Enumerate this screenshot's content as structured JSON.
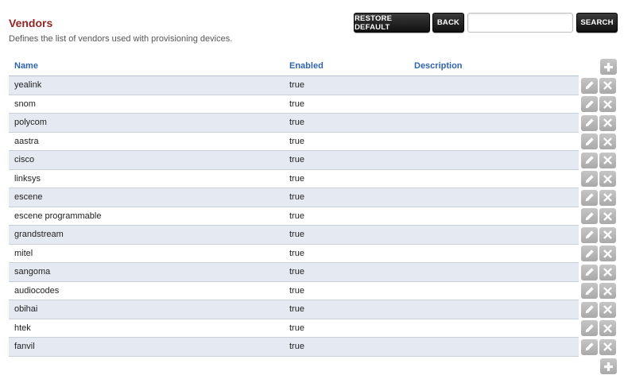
{
  "page": {
    "title": "Vendors",
    "description": "Defines the list of vendors used with provisioning devices."
  },
  "toolbar": {
    "restore_label": "RESTORE DEFAULT",
    "back_label": "BACK",
    "search_placeholder": "",
    "search_value": "",
    "search_label": "SEARCH"
  },
  "table": {
    "headers": {
      "name": "Name",
      "enabled": "Enabled",
      "description": "Description"
    },
    "rows": [
      {
        "name": "yealink",
        "enabled": "true",
        "description": ""
      },
      {
        "name": "snom",
        "enabled": "true",
        "description": ""
      },
      {
        "name": "polycom",
        "enabled": "true",
        "description": ""
      },
      {
        "name": "aastra",
        "enabled": "true",
        "description": ""
      },
      {
        "name": "cisco",
        "enabled": "true",
        "description": ""
      },
      {
        "name": "linksys",
        "enabled": "true",
        "description": ""
      },
      {
        "name": "escene",
        "enabled": "true",
        "description": ""
      },
      {
        "name": "escene programmable",
        "enabled": "true",
        "description": ""
      },
      {
        "name": "grandstream",
        "enabled": "true",
        "description": ""
      },
      {
        "name": "mitel",
        "enabled": "true",
        "description": ""
      },
      {
        "name": "sangoma",
        "enabled": "true",
        "description": ""
      },
      {
        "name": "audiocodes",
        "enabled": "true",
        "description": ""
      },
      {
        "name": "obihai",
        "enabled": "true",
        "description": ""
      },
      {
        "name": "htek",
        "enabled": "true",
        "description": ""
      },
      {
        "name": "fanvil",
        "enabled": "true",
        "description": ""
      }
    ]
  },
  "icons": {
    "add": "plus-icon",
    "edit": "pencil-icon",
    "delete": "close-icon"
  },
  "colors": {
    "title": "#952424",
    "header_text": "#3164ad",
    "row_alt": "#e5e9f1",
    "button_dark": "#111111",
    "icon_button": "#b5b5b5"
  }
}
